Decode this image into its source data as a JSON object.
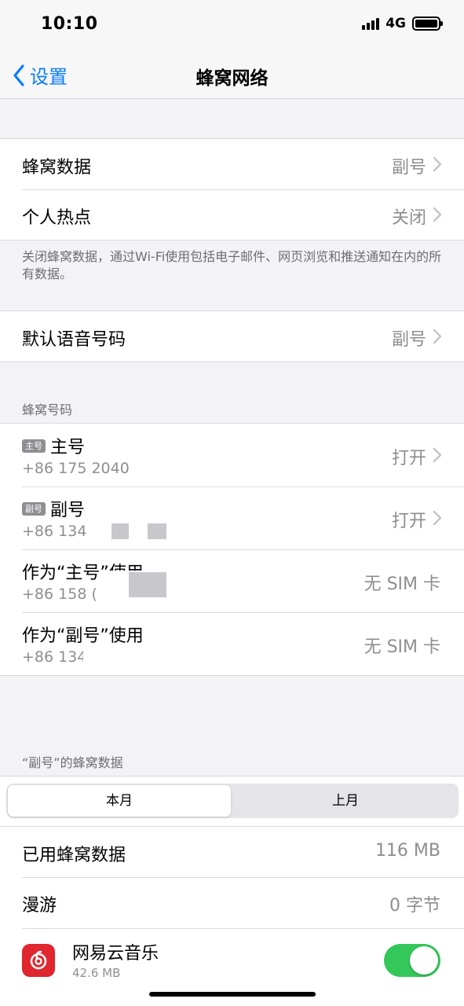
{
  "status_bar": {
    "time": "10:10",
    "network": "4G"
  },
  "nav": {
    "back_label": "设置",
    "title": "蜂窝网络"
  },
  "group1": {
    "rows": [
      {
        "label": "蜂窝数据",
        "value": "副号"
      },
      {
        "label": "个人热点",
        "value": "关闭"
      }
    ],
    "footer": "关闭蜂窝数据，通过Wi-Fi使用包括电子邮件、网页浏览和推送通知在内的所有数据。"
  },
  "group2": {
    "label": "默认语音号码",
    "value": "副号"
  },
  "numbers_section": {
    "header": "蜂窝号码",
    "rows": [
      {
        "tag": "主号",
        "title": "主号",
        "number": "+86 175 2040",
        "value": "打开"
      },
      {
        "tag": "副号",
        "title": "副号",
        "number": "+86 134",
        "value": "打开"
      },
      {
        "title": "作为“主号”使用",
        "number": "+86 158 (",
        "value": "无 SIM 卡"
      },
      {
        "title": "作为“副号”使用",
        "number": "+86 134",
        "value": "无 SIM 卡"
      }
    ]
  },
  "data_section": {
    "header": "“副号”的蜂窝数据",
    "segments": [
      "本月",
      "上月"
    ],
    "rows": [
      {
        "label": "已用蜂窝数据",
        "value": "116 MB"
      },
      {
        "label": "漫游",
        "value": "0 字节"
      }
    ],
    "app": {
      "name": "网易云音乐",
      "size": "42.6 MB",
      "icon": "netease-music-icon",
      "enabled": true
    }
  },
  "colors": {
    "accent": "#0a7cff",
    "toggle_on": "#34c759",
    "app_icon": "#e0262e"
  }
}
